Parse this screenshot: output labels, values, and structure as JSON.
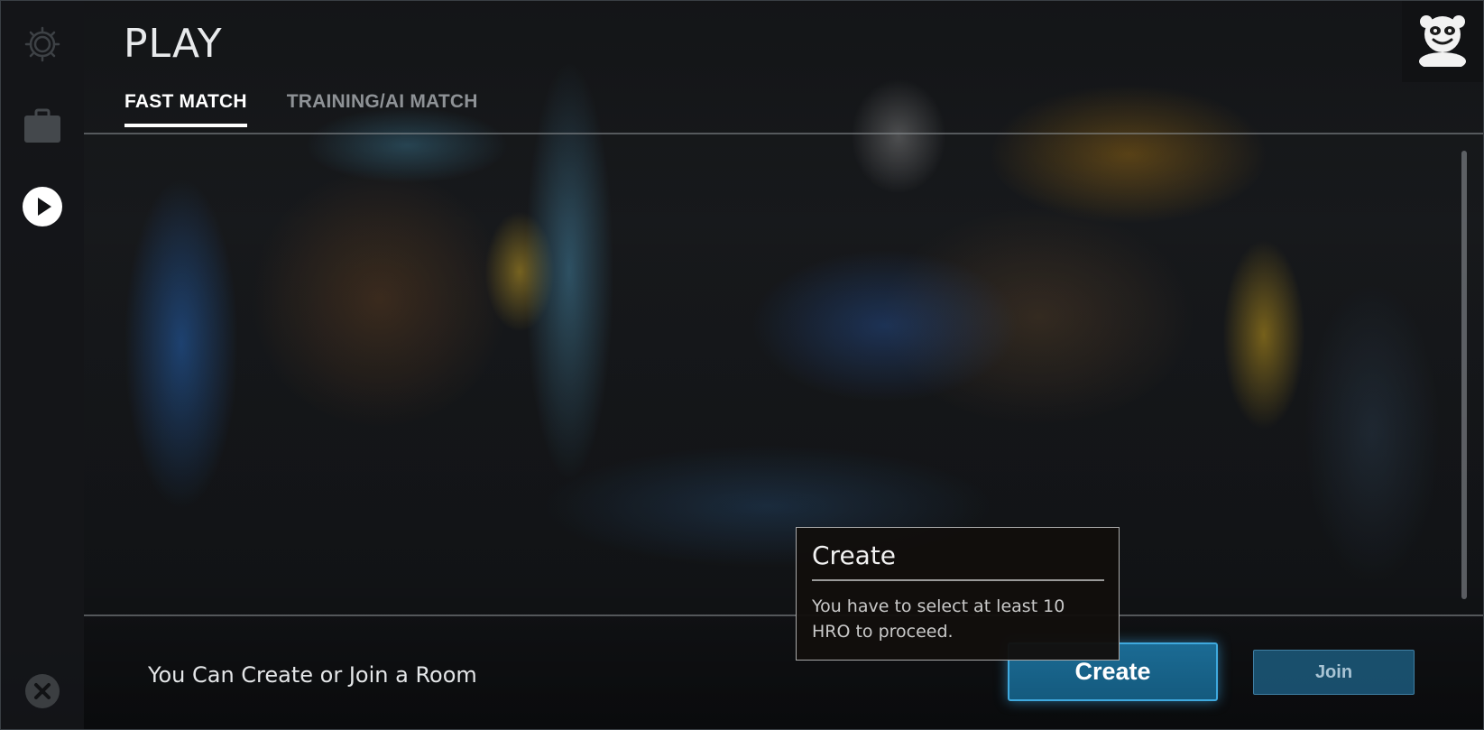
{
  "header": {
    "title": "PLAY",
    "tabs": [
      {
        "label": "FAST MATCH",
        "active": true
      },
      {
        "label": "TRAINING/AI MATCH",
        "active": false
      }
    ]
  },
  "sidebar": {
    "items": [
      {
        "icon": "gear-icon",
        "state": "inactive"
      },
      {
        "icon": "briefcase-icon",
        "state": "inactive"
      },
      {
        "icon": "play-icon",
        "state": "active"
      },
      {
        "icon": "close-icon",
        "state": "inactive"
      }
    ]
  },
  "footer": {
    "message": "You Can Create or Join a Room",
    "create_label": "Create",
    "join_label": "Join"
  },
  "tooltip": {
    "title": "Create",
    "body": "You have to select at least 10 HRO to proceed."
  },
  "avatar": {
    "icon": "panda-avatar-icon"
  },
  "colors": {
    "accent": "#3fa9de",
    "create_bg": "#1b6b94",
    "join_bg": "#1c5a7d",
    "tab_active": "#ffffff",
    "tab_inactive": "#8e9296"
  }
}
